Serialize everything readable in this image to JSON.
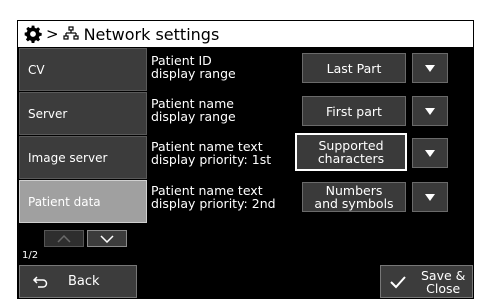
{
  "header": {
    "gear_icon": "gear-icon",
    "separator": ">",
    "network_icon": "network-icon",
    "title": "Network settings"
  },
  "sidebar": {
    "items": [
      {
        "label": "CV",
        "active": false
      },
      {
        "label": "Server",
        "active": false
      },
      {
        "label": "Image server",
        "active": false
      },
      {
        "label": "Patient data",
        "active": true
      }
    ],
    "page_indicator": "1/2"
  },
  "settings": [
    {
      "label_line1": "Patient ID",
      "label_line2": "display range",
      "value_line1": "Last Part",
      "value_line2": ""
    },
    {
      "label_line1": "Patient name",
      "label_line2": "display range",
      "value_line1": "First part",
      "value_line2": ""
    },
    {
      "label_line1": "Patient name text",
      "label_line2": "display priority: 1st",
      "value_line1": "Supported",
      "value_line2": "characters"
    },
    {
      "label_line1": "Patient name text",
      "label_line2": "display priority: 2nd",
      "value_line1": "Numbers",
      "value_line2": "and symbols"
    }
  ],
  "footer": {
    "back_label": "Back",
    "save_line1": "Save &",
    "save_line2": "Close"
  },
  "colors": {
    "background": "#000000",
    "button": "#3c3c3c",
    "active_item": "#a0a0a0",
    "text": "#ffffff"
  }
}
